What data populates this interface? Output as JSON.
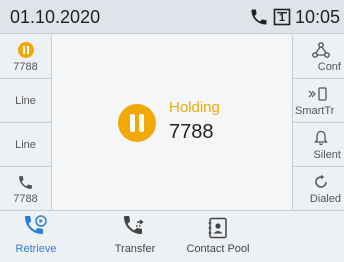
{
  "status_bar": {
    "date": "01.10.2020",
    "line_badge": "1",
    "time": "10:05"
  },
  "left_keys": [
    {
      "label": "7788",
      "icon": "pause-icon"
    },
    {
      "label": "Line",
      "icon": ""
    },
    {
      "label": "Line",
      "icon": ""
    },
    {
      "label": "7788",
      "icon": "phone-icon"
    }
  ],
  "right_keys": [
    {
      "label": "Conf",
      "icon": "conference-icon"
    },
    {
      "label": "SmartTr",
      "icon": "smart-transfer-icon"
    },
    {
      "label": "Silent",
      "icon": "bell-icon"
    },
    {
      "label": "Dialed",
      "icon": "redial-icon"
    }
  ],
  "call": {
    "status": "Holding",
    "number": "7788"
  },
  "softkeys": [
    {
      "label": "Retrieve",
      "icon": "retrieve-icon",
      "active": true
    },
    {
      "label": "Transfer",
      "icon": "transfer-icon",
      "active": false
    },
    {
      "label": "Contact Pool",
      "icon": "contact-card-icon",
      "active": false
    }
  ],
  "colors": {
    "hold_accent": "#f2a807",
    "active_softkey": "#2d7fd6",
    "status_bar_bg": "#dfe4ea"
  }
}
